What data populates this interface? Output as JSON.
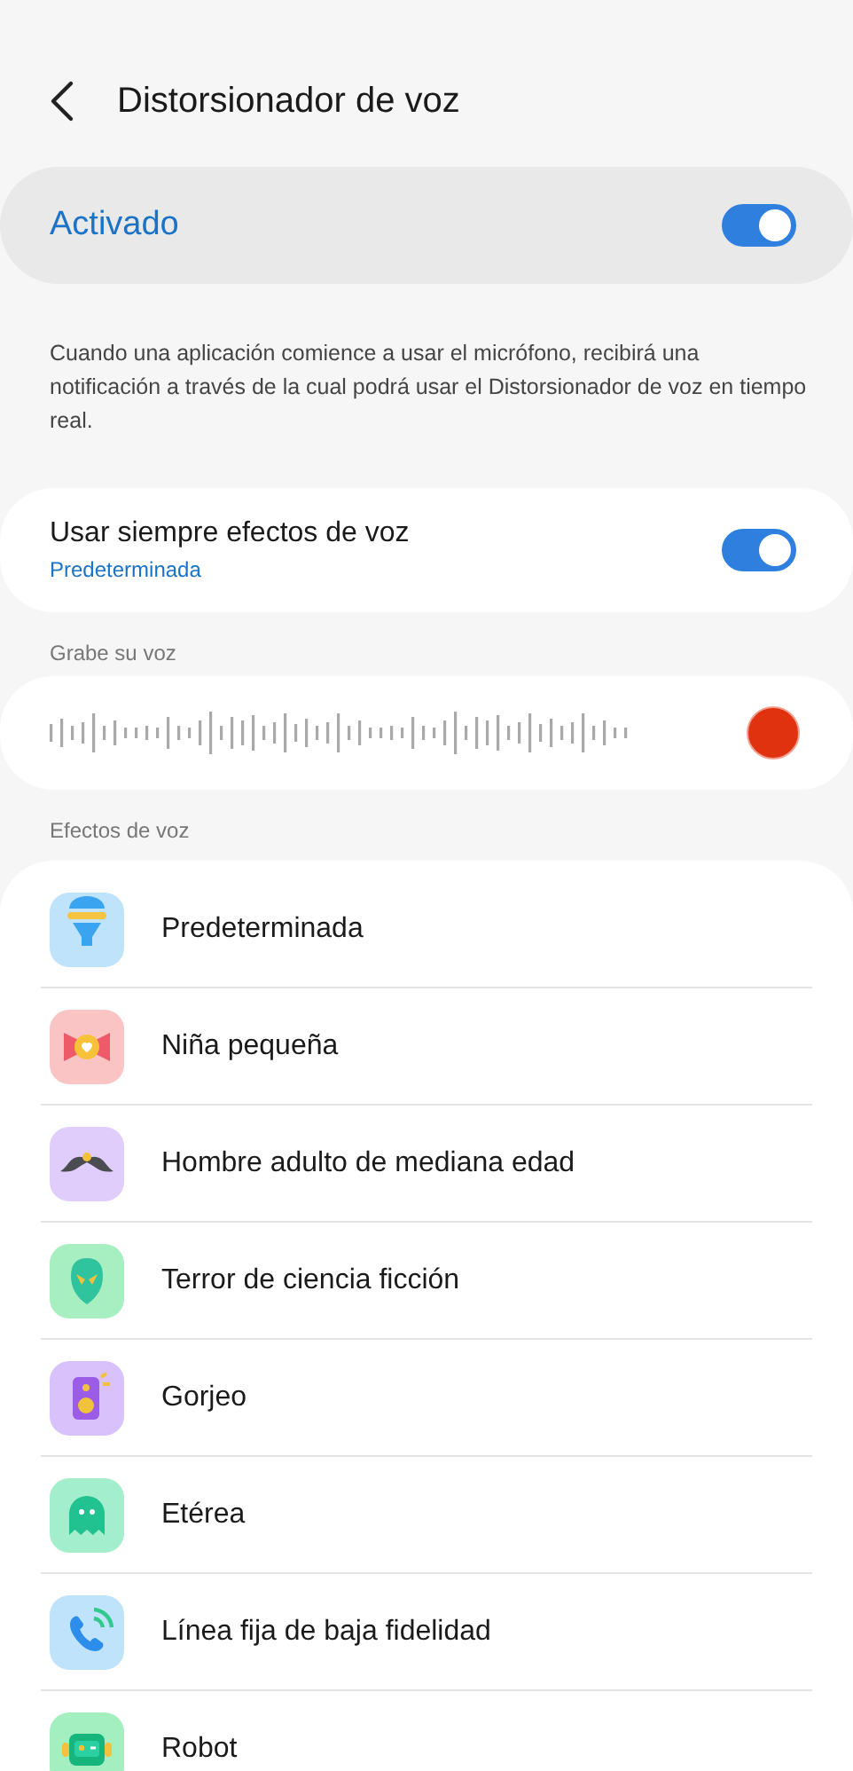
{
  "header": {
    "title": "Distorsionador de voz"
  },
  "master": {
    "label": "Activado",
    "on": true
  },
  "description": "Cuando una aplicación comience a usar el micrófono, recibirá una notificación a través de la cual podrá usar el Distorsionador de voz en tiempo real.",
  "always": {
    "label": "Usar siempre efectos de voz",
    "sublabel": "Predeterminada",
    "on": true
  },
  "record": {
    "heading": "Grabe su voz"
  },
  "effects": {
    "heading": "Efectos de voz",
    "items": [
      {
        "label": "Predeterminada",
        "kind": "lamp"
      },
      {
        "label": "Niña pequeña",
        "kind": "bow"
      },
      {
        "label": "Hombre adulto de mediana edad",
        "kind": "mustache"
      },
      {
        "label": "Terror de ciencia ficción",
        "kind": "alien"
      },
      {
        "label": "Gorjeo",
        "kind": "speaker"
      },
      {
        "label": "Etérea",
        "kind": "ghost"
      },
      {
        "label": "Línea fija de baja fidelidad",
        "kind": "phone"
      },
      {
        "label": "Robot",
        "kind": "robot"
      }
    ]
  }
}
